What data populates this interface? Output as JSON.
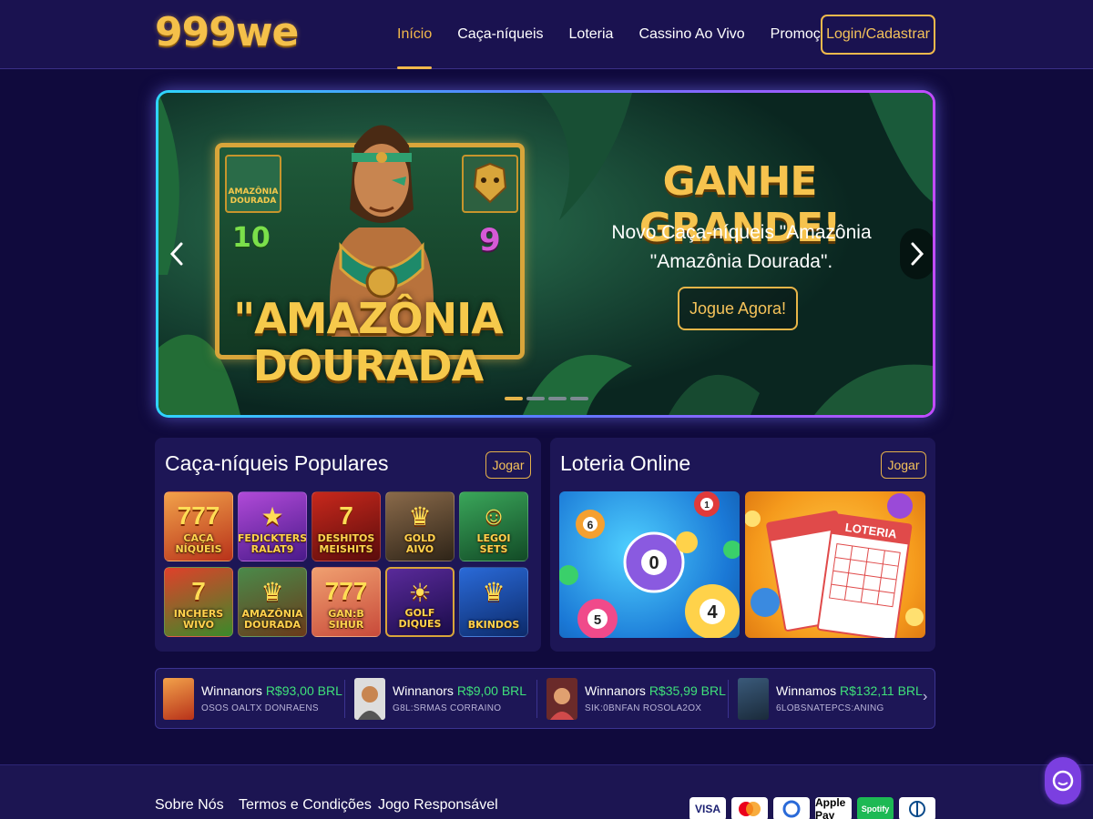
{
  "header": {
    "logo": "999we",
    "nav": [
      {
        "label": "Início",
        "active": true
      },
      {
        "label": "Caça-níqueis",
        "active": false
      },
      {
        "label": "Loteria",
        "active": false
      },
      {
        "label": "Cassino Ao Vivo",
        "active": false
      },
      {
        "label": "Promoções",
        "active": false
      }
    ],
    "login_label": "Login/Cadastrar"
  },
  "banner": {
    "game_title": "\"AMAZÔNIA DOURADA",
    "headline": "GANHE GRANDE!",
    "subtitle": "Novo Caça-níqueis \"Amazônia \"Amazônia Dourada\".",
    "cta": "Jogue Agora!",
    "slot_symbols": [
      "AMAZÔNIA DOURADA",
      "10",
      "9"
    ],
    "active_slide": 1,
    "slide_count": 4
  },
  "slots_panel": {
    "title": "Caça-níqueis Populares",
    "button": "Jogar",
    "games": [
      {
        "name": "CAÇA NÍQUEIS",
        "deco": "777"
      },
      {
        "name": "FEDICKTERS RALAT9",
        "deco": "★"
      },
      {
        "name": "DESHITOS MEISHITS",
        "deco": "7"
      },
      {
        "name": "GOLD AIVO",
        "deco": "♛"
      },
      {
        "name": "LEGOI SETS",
        "deco": "☺"
      },
      {
        "name": "INCHERS WIVO",
        "deco": "7"
      },
      {
        "name": "AMAZÔNIA DOURADA",
        "deco": "♛"
      },
      {
        "name": "GAN:B SIHUR",
        "deco": "777"
      },
      {
        "name": "GOLF DIQUES",
        "deco": "☀"
      },
      {
        "name": "BKINDOS",
        "deco": "♛"
      }
    ]
  },
  "lottery_panel": {
    "title": "Loteria Online",
    "button": "Jogar",
    "balls": [
      "6",
      "0",
      "4",
      "5",
      "1"
    ],
    "ticket_label": "LOTERIA"
  },
  "winners": [
    {
      "prefix": "Winnanors",
      "amount": "R$93,00 BRL",
      "game": "OSOS OALTX DONRAENS"
    },
    {
      "prefix": "Winnanors",
      "amount": "R$9,00 BRL",
      "game": "G8L:SRMAS CORRAINO"
    },
    {
      "prefix": "Winnanors",
      "amount": "R$35,99 BRL",
      "game": "SIK:0BNFAN ROSOLA2OX"
    },
    {
      "prefix": "Winnamos",
      "amount": "R$132,11 BRL",
      "game": "6LOBSNATEPCS:ANING"
    }
  ],
  "footer": {
    "links": [
      "Sobre Nós",
      "Termos e Condições",
      "Jogo Responsável"
    ],
    "payments": [
      "VISA",
      "mastercard",
      "elo",
      "Apple Pay",
      "Spotify",
      "diners"
    ]
  },
  "colors": {
    "background": "#100a3d",
    "accent_gold": "#f2b84b",
    "win_green": "#3fe07a"
  }
}
